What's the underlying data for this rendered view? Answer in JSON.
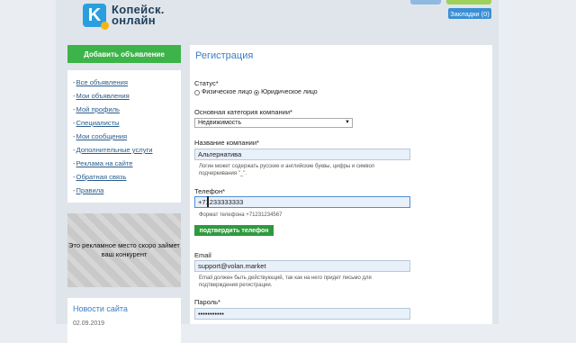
{
  "header": {
    "logo_letter": "K",
    "logo_line1": "Копейск.",
    "logo_line2": "онлайн",
    "bookmarks_label": "Закладки (0)"
  },
  "sidebar": {
    "add_button": "Добавить объявление",
    "menu": [
      "Все объявления",
      "Мои объявления",
      "Мой профиль",
      "Специалисты",
      "Мои сообщения",
      "Дополнительные услуги",
      "Реклама на сайте",
      "Обратная связь",
      "Правила"
    ],
    "ad_text": "Это рекламное место скоро займет ваш конкурент",
    "news_title": "Новости сайта",
    "news_date": "02.09.2019"
  },
  "form": {
    "title": "Регистрация",
    "status_label": "Статус*",
    "status_options": [
      "Физическое лицо",
      "Юридическое лицо"
    ],
    "status_selected": "Юридическое лицо",
    "category_label": "Основная категория компании*",
    "category_value": "Недвижимость",
    "company_label": "Название компании*",
    "company_value": "Альтернатива",
    "company_hint": "Логин может содержать русские и английские буквы, цифры и символ подчеркивания \"_\".",
    "phone_label": "Телефон*",
    "phone_value": "+71233333333",
    "phone_hint": "Формат телефона +71231234567",
    "confirm_phone_button": "подтвердить телефон",
    "email_label": "Email",
    "email_value": "support@volan.market",
    "email_hint": "Email должен быть действующий, так как на него придет письмо для подтверждения регистрации.",
    "password_label": "Пароль*",
    "password_value": "•••••••••••"
  },
  "colors": {
    "accent_green": "#3db449",
    "link_blue": "#2a5d8e",
    "title_blue": "#3a7ec4"
  }
}
